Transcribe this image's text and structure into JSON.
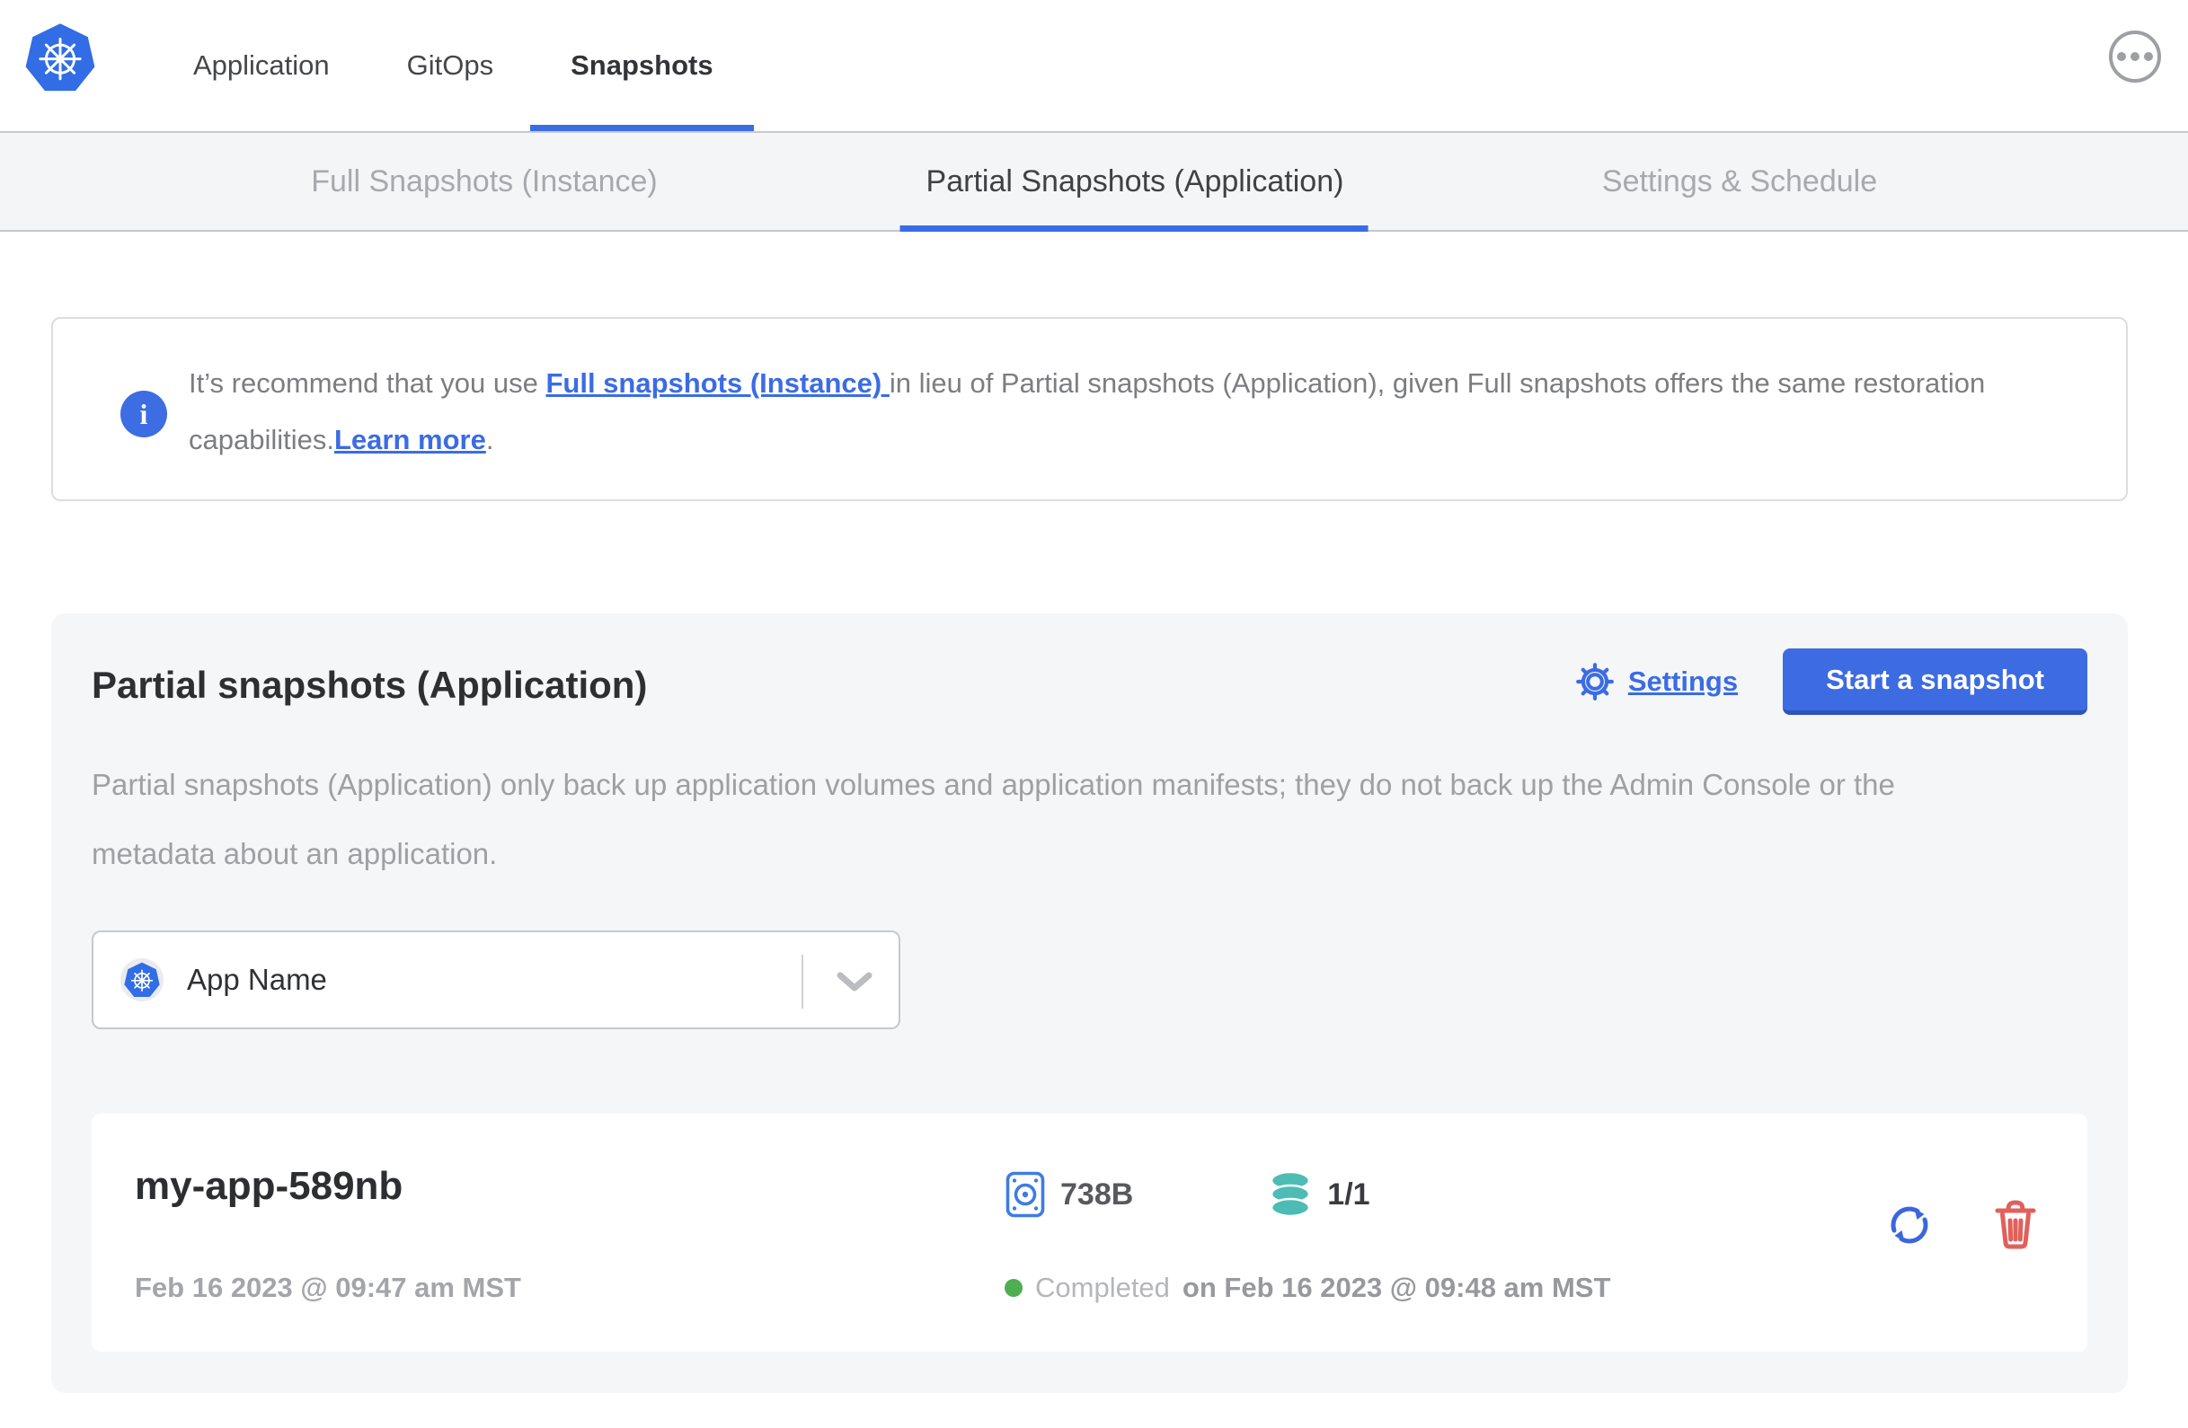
{
  "topnav": {
    "items": [
      {
        "label": "Application",
        "active": false
      },
      {
        "label": "GitOps",
        "active": false
      },
      {
        "label": "Snapshots",
        "active": true
      }
    ]
  },
  "subnav": {
    "tabs": [
      {
        "label": "Full Snapshots (Instance)",
        "active": false
      },
      {
        "label": "Partial Snapshots (Application)",
        "active": true
      },
      {
        "label": "Settings & Schedule",
        "active": false
      }
    ]
  },
  "callout": {
    "text_start": "It’s recommend that you use ",
    "instance_link": "Full snapshots (Instance) ",
    "text_middle": "in lieu of Partial snapshots (Application), given Full snapshots offers the same restoration capabilities.",
    "learn_more_link": "Learn more",
    "text_end": "."
  },
  "panel": {
    "title": "Partial snapshots (Application)",
    "settings_link": "Settings",
    "start_snapshot_button": "Start a snapshot",
    "description": "Partial snapshots (Application) only back up application volumes and application manifests; they do not back up the Admin Console or the metadata about an application.",
    "app_selector": {
      "value": "App Name"
    }
  },
  "snapshot_row": {
    "name": "my-app-589nb",
    "started_at": "Feb 16 2023 @ 09:47 am MST",
    "size": "738B",
    "volumes": "1/1",
    "status": "Completed",
    "completed_at": "on Feb 16 2023 @ 09:48 am MST"
  },
  "colors": {
    "accent_blue": "#3b6ce4",
    "button_blue": "#3d6be2",
    "volume_teal": "#4cbcb4",
    "status_green": "#4fad52",
    "danger_red": "#e0605b"
  }
}
